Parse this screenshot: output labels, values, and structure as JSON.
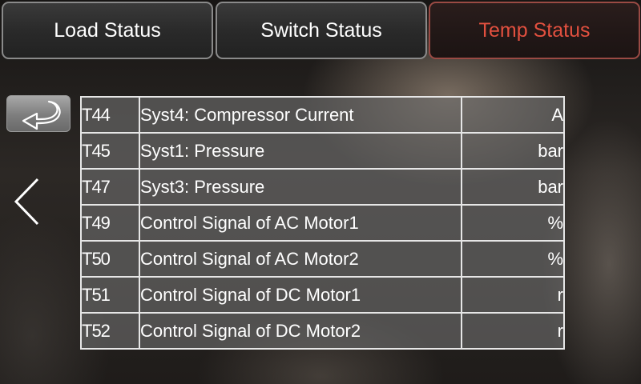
{
  "tabs": [
    {
      "label": "Load Status",
      "active": false
    },
    {
      "label": "Switch Status",
      "active": false
    },
    {
      "label": "Temp Status",
      "active": true
    }
  ],
  "accent_color": "#e2503f",
  "icons": {
    "back": "return-arrow-icon",
    "previous": "chevron-left-icon"
  },
  "rows": [
    {
      "code": "T44",
      "name": "Syst4: Compressor Current",
      "unit": "A"
    },
    {
      "code": "T45",
      "name": "Syst1: Pressure",
      "unit": "bar"
    },
    {
      "code": "T47",
      "name": "Syst3: Pressure",
      "unit": "bar"
    },
    {
      "code": "T49",
      "name": "Control Signal of AC Motor1",
      "unit": "%"
    },
    {
      "code": "T50",
      "name": "Control Signal of AC Motor2",
      "unit": "%"
    },
    {
      "code": "T51",
      "name": "Control Signal of DC Motor1",
      "unit": "r"
    },
    {
      "code": "T52",
      "name": "Control Signal of DC Motor2",
      "unit": "r"
    }
  ]
}
